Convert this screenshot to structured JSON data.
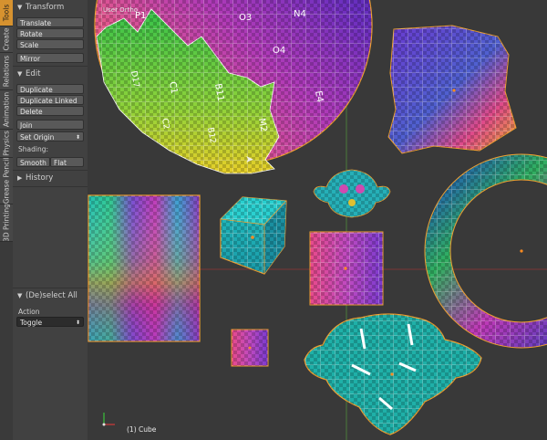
{
  "tabs": [
    {
      "label": "Tools",
      "active": true
    },
    {
      "label": "Create",
      "active": false
    },
    {
      "label": "Relations",
      "active": false
    },
    {
      "label": "Animation",
      "active": false
    },
    {
      "label": "Physics",
      "active": false
    },
    {
      "label": "Grease Pencil",
      "active": false
    },
    {
      "label": "3D Printing",
      "active": false
    }
  ],
  "transform": {
    "title": "Transform",
    "translate": "Translate",
    "rotate": "Rotate",
    "scale": "Scale",
    "mirror": "Mirror"
  },
  "edit": {
    "title": "Edit",
    "duplicate": "Duplicate",
    "duplicate_linked": "Duplicate Linked",
    "delete": "Delete",
    "join": "Join",
    "set_origin": "Set Origin",
    "shading_label": "Shading:",
    "smooth": "Smooth",
    "flat": "Flat"
  },
  "history": {
    "title": "History"
  },
  "operator": {
    "title": "(De)select All",
    "action_label": "Action",
    "action_value": "Toggle"
  },
  "viewport": {
    "view_label": "User Ortho",
    "object_label": "(1) Cube",
    "sphere_labels": [
      "P1",
      "O3",
      "N4",
      "O4",
      "D17",
      "C1",
      "B11",
      "B12",
      "C2",
      "M2",
      "E4"
    ],
    "colors": {
      "background": "#393939",
      "selection_outline": "#f0a030",
      "x_axis": "#a03838",
      "y_axis": "#5a9a3a",
      "uv_grid": "#ffffff"
    }
  }
}
